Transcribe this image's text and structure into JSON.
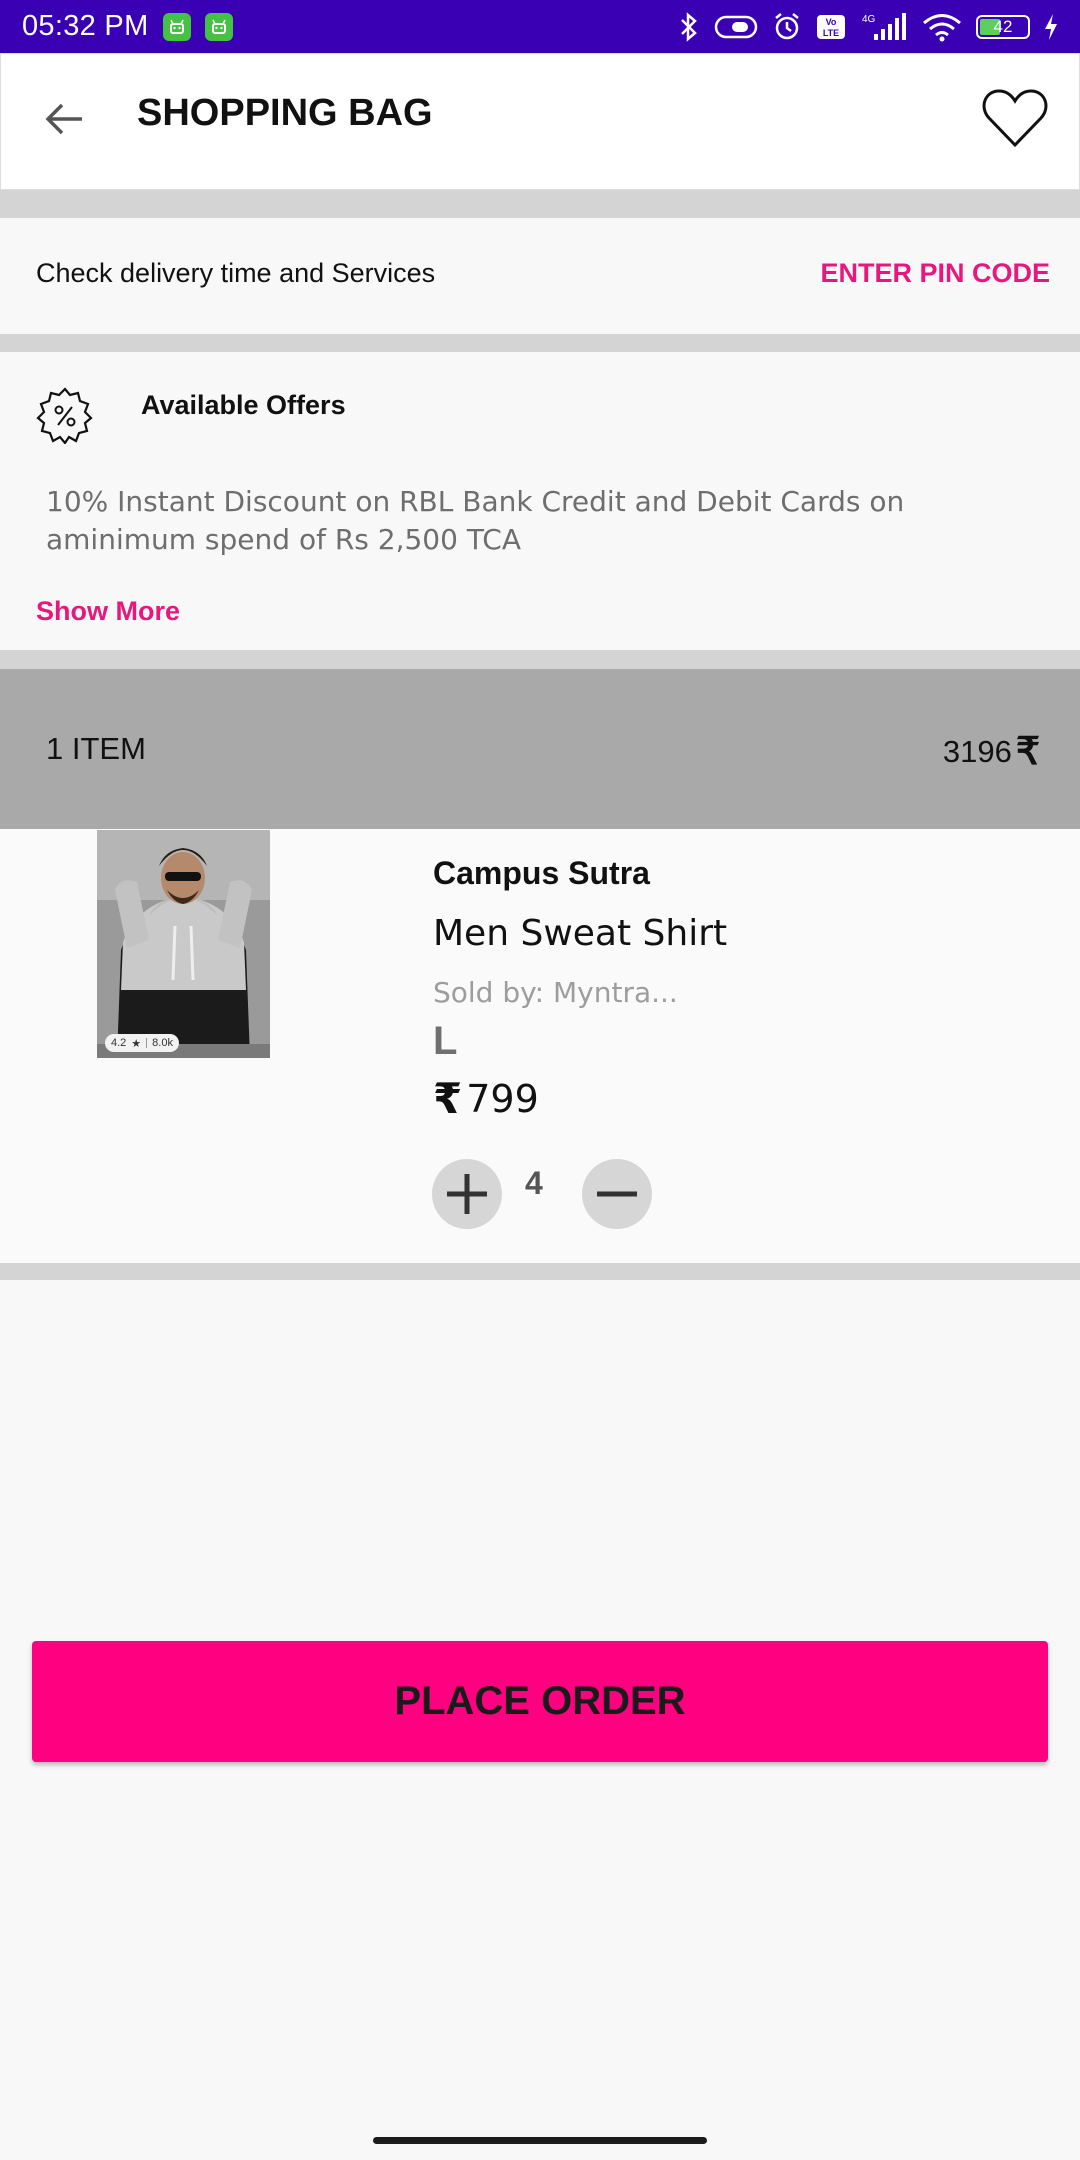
{
  "status_bar": {
    "time": "05:32 PM",
    "battery": "42",
    "network": "4G",
    "icons": [
      "android-notification-icon",
      "android-notification-icon",
      "bluetooth-icon",
      "toggle-icon",
      "alarm-icon",
      "volte-icon",
      "signal-icon",
      "wifi-icon",
      "battery-icon",
      "charging-icon"
    ]
  },
  "header": {
    "title": "SHOPPING BAG",
    "back_icon": "arrow-left-icon",
    "wishlist_icon": "heart-icon"
  },
  "delivery": {
    "text": "Check delivery time and Services",
    "action": "ENTER PIN CODE"
  },
  "offers": {
    "icon": "discount-badge-icon",
    "title": "Available Offers",
    "description": "10% Instant Discount on RBL Bank Credit and Debit Cards on aminimum spend of Rs 2,500 TCA",
    "show_more": "Show More"
  },
  "bag": {
    "count_label": "1 ITEM",
    "total": "3196",
    "currency": "₹"
  },
  "item": {
    "brand": "Campus Sutra",
    "name": "Men Sweat Shirt",
    "seller": "Sold by: Myntra...",
    "size": "L",
    "price": "799",
    "currency": "₹",
    "quantity": "4",
    "rating": "4.2",
    "rating_count": "8.0k"
  },
  "actions": {
    "place_order": "PLACE ORDER"
  },
  "colors": {
    "status_bar": "#3a00b4",
    "accent": "#e8177e",
    "place_order": "#ff0080",
    "item_bar": "#a9a9a9"
  }
}
